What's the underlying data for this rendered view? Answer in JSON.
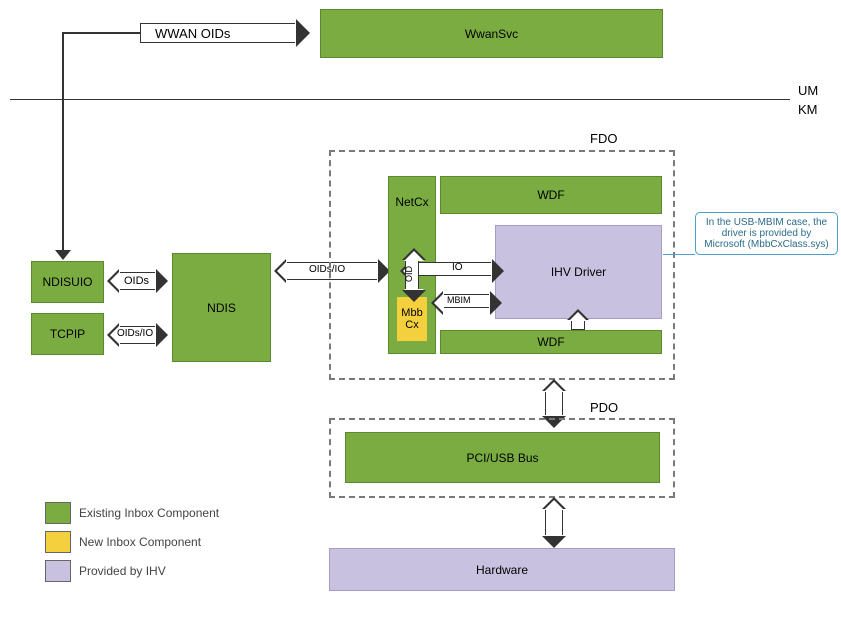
{
  "top": {
    "wwan_oids_label": "WWAN OIDs",
    "wwansvc_label": "WwanSvc"
  },
  "mode": {
    "um_label": "UM",
    "km_label": "KM"
  },
  "left_stack": {
    "ndisuio_label": "NDISUIO",
    "tcpip_label": "TCPIP",
    "ndis_label": "NDIS",
    "oids_label": "OIDs",
    "oids_io_label": "OIDs/IO"
  },
  "middle_arrows": {
    "oids_io_left": "OIDs/IO",
    "io_right": "IO",
    "oid_vertical": "OID",
    "mbim_label": "MBIM"
  },
  "fdo": {
    "title": "FDO",
    "netcx_label": "NetCx",
    "wdf_top_label": "WDF",
    "wdf_bottom_label": "WDF",
    "mbbcx_label": "Mbb\nCx",
    "ihv_driver_label": "IHV Driver"
  },
  "callout": {
    "text": "In the USB-MBIM case, the driver is provided by Microsoft (MbbCxClass.sys)"
  },
  "pdo": {
    "title": "PDO",
    "pci_usb_bus_label": "PCI/USB Bus"
  },
  "hardware": {
    "label": "Hardware"
  },
  "legend": {
    "existing_label": "Existing Inbox Component",
    "new_label": "New Inbox Component",
    "provided_label": "Provided by IHV"
  },
  "colors": {
    "green": "#7aac42",
    "yellow": "#f4cf3e",
    "purple": "#c9c1e0"
  }
}
